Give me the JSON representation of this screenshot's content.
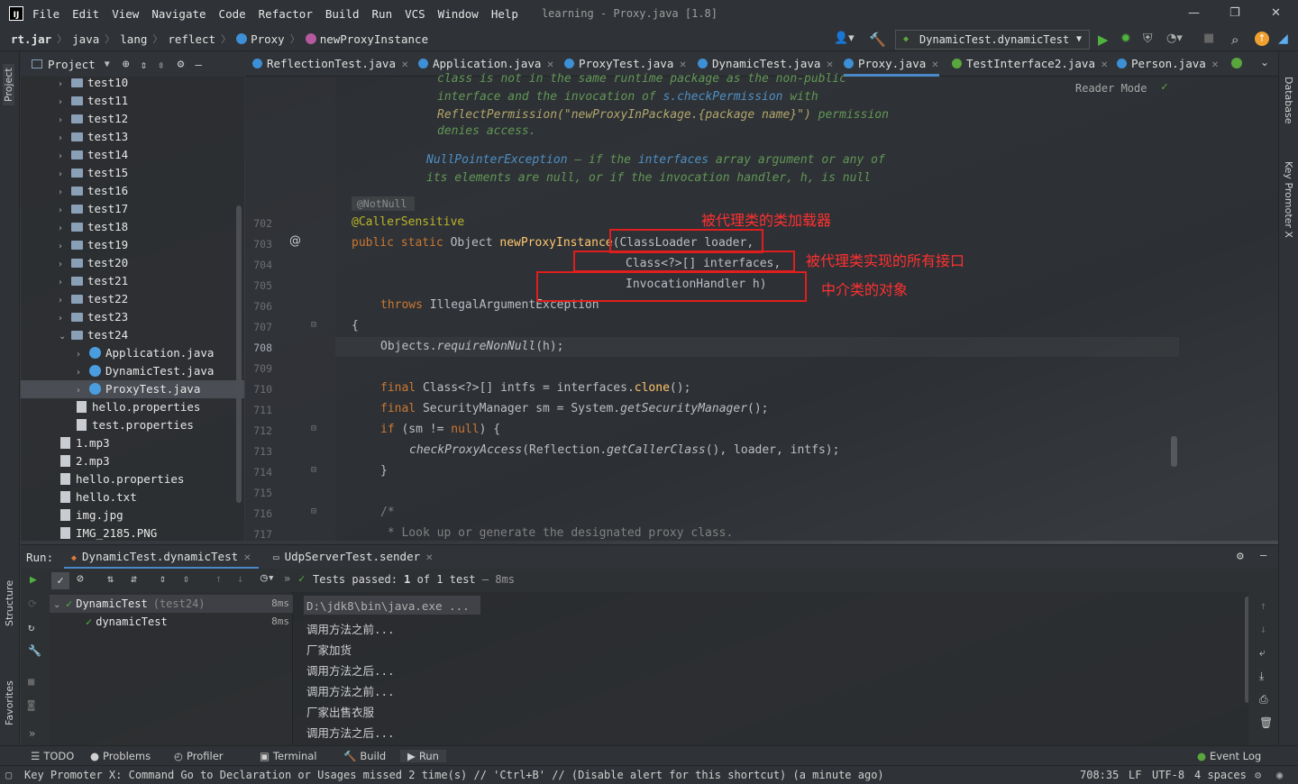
{
  "window": {
    "title": "learning - Proxy.java [1.8]"
  },
  "menu": [
    "File",
    "Edit",
    "View",
    "Navigate",
    "Code",
    "Refactor",
    "Build",
    "Run",
    "VCS",
    "Window",
    "Help"
  ],
  "breadcrumb": [
    "rt.jar",
    "java",
    "lang",
    "reflect",
    "Proxy",
    "newProxyInstance"
  ],
  "run_config": "DynamicTest.dynamicTest",
  "left_strip": {
    "project": "Project",
    "structure": "Structure",
    "favorites": "Favorites"
  },
  "right_strip": {
    "database": "Database",
    "key_promoter": "Key Promoter X"
  },
  "project_panel": {
    "title": "Project"
  },
  "project_tree": [
    {
      "label": "test10",
      "kind": "folder",
      "depth": 0,
      "arrow": "›"
    },
    {
      "label": "test11",
      "kind": "folder",
      "depth": 0,
      "arrow": "›"
    },
    {
      "label": "test12",
      "kind": "folder",
      "depth": 0,
      "arrow": "›"
    },
    {
      "label": "test13",
      "kind": "folder",
      "depth": 0,
      "arrow": "›"
    },
    {
      "label": "test14",
      "kind": "folder",
      "depth": 0,
      "arrow": "›"
    },
    {
      "label": "test15",
      "kind": "folder",
      "depth": 0,
      "arrow": "›"
    },
    {
      "label": "test16",
      "kind": "folder",
      "depth": 0,
      "arrow": "›"
    },
    {
      "label": "test17",
      "kind": "folder",
      "depth": 0,
      "arrow": "›"
    },
    {
      "label": "test18",
      "kind": "folder",
      "depth": 0,
      "arrow": "›"
    },
    {
      "label": "test19",
      "kind": "folder",
      "depth": 0,
      "arrow": "›"
    },
    {
      "label": "test20",
      "kind": "folder",
      "depth": 0,
      "arrow": "›"
    },
    {
      "label": "test21",
      "kind": "folder",
      "depth": 0,
      "arrow": "›"
    },
    {
      "label": "test22",
      "kind": "folder",
      "depth": 0,
      "arrow": "›"
    },
    {
      "label": "test23",
      "kind": "folder",
      "depth": 0,
      "arrow": "›"
    },
    {
      "label": "test24",
      "kind": "folder",
      "depth": 0,
      "arrow": "⌄"
    },
    {
      "label": "Application.java",
      "kind": "java",
      "depth": 1,
      "arrow": "›"
    },
    {
      "label": "DynamicTest.java",
      "kind": "java",
      "depth": 1,
      "arrow": "›"
    },
    {
      "label": "ProxyTest.java",
      "kind": "java",
      "depth": 1,
      "arrow": "›",
      "selected": true
    },
    {
      "label": "hello.properties",
      "kind": "file",
      "depth": 1,
      "arrow": ""
    },
    {
      "label": "test.properties",
      "kind": "file",
      "depth": 1,
      "arrow": ""
    },
    {
      "label": "1.mp3",
      "kind": "file",
      "depth": 0,
      "arrow": ""
    },
    {
      "label": "2.mp3",
      "kind": "file",
      "depth": 0,
      "arrow": ""
    },
    {
      "label": "hello.properties",
      "kind": "file",
      "depth": 0,
      "arrow": ""
    },
    {
      "label": "hello.txt",
      "kind": "file",
      "depth": 0,
      "arrow": ""
    },
    {
      "label": "img.jpg",
      "kind": "file",
      "depth": 0,
      "arrow": ""
    },
    {
      "label": "IMG_2185.PNG",
      "kind": "file",
      "depth": 0,
      "arrow": ""
    }
  ],
  "tabs": [
    {
      "label": "ReflectionTest.java",
      "icon": "c"
    },
    {
      "label": "Application.java",
      "icon": "c"
    },
    {
      "label": "ProxyTest.java",
      "icon": "c"
    },
    {
      "label": "DynamicTest.java",
      "icon": "c"
    },
    {
      "label": "Proxy.java",
      "icon": "c",
      "active": true
    },
    {
      "label": "TestInterface2.java",
      "icon": "i"
    },
    {
      "label": "Person.java",
      "icon": "c"
    }
  ],
  "editor": {
    "reader_mode": "Reader Mode",
    "doc": {
      "l1": "class is not in the same runtime package as the non-public",
      "l2a": "interface and the invocation of ",
      "l2b": "s.checkPermission",
      "l2c": " with",
      "l3a": "ReflectPermission(\"newProxyInPackage.{package name}\")",
      "l3b": " permission",
      "l4": "denies access.",
      "l5a": "NullPointerException",
      "l5b": " – if the ",
      "l5c": "interfaces",
      "l5d": " array argument or any of",
      "l6": "its elements are null, or if the invocation handler, h, is null"
    },
    "notnull": "@NotNull",
    "line_numbers": [
      "702",
      "703",
      "704",
      "705",
      "706",
      "707",
      "708",
      "709",
      "710",
      "711",
      "712",
      "713",
      "714",
      "715",
      "716",
      "717"
    ],
    "code": {
      "l702": "@CallerSensitive",
      "l703a": "public static ",
      "l703b": "Object ",
      "l703c": "newProxyInstance",
      "l703d": "(",
      "l703e": "ClassLoader",
      "l703f": " loader,",
      "l704a": "Class",
      "l704b": "<?>[] interfaces,",
      "l705a": "InvocationHandler",
      "l705b": " h)",
      "l706a": "throws ",
      "l706b": "IllegalArgumentException",
      "l707": "{",
      "l708a": "Objects.",
      "l708b": "requireNonNull",
      "l708c": "(h);",
      "l710a": "final ",
      "l710b": "Class",
      "l710c": "<?>[] intfs = interfaces.",
      "l710d": "clone",
      "l710e": "();",
      "l711a": "final ",
      "l711b": "SecurityManager",
      "l711c": " sm = ",
      "l711d": "System.",
      "l711e": "getSecurityManager",
      "l711f": "();",
      "l712a": "if ",
      "l712b": "(sm != ",
      "l712c": "null",
      "l712d": ") {",
      "l713a": "checkProxyAccess",
      "l713b": "(Reflection.",
      "l713c": "getCallerClass",
      "l713d": "(), loader, intfs);",
      "l714": "}",
      "l716": "/*",
      "l717": " * Look up or generate the designated proxy class."
    },
    "annotations": {
      "a1": "被代理类的类加载器",
      "a2": "被代理类实现的所有接口",
      "a3": "中介类的对象"
    }
  },
  "run_panel": {
    "label": "Run:",
    "tabs": [
      "DynamicTest.dynamicTest",
      "UdpServerTest.sender"
    ],
    "status": "Tests passed:",
    "status_count": "1",
    "status_rest": "of 1 test",
    "status_time": "– 8ms",
    "tree": [
      {
        "name": "DynamicTest",
        "sub": "(test24)",
        "time": "8ms"
      },
      {
        "name": "dynamicTest",
        "sub": "",
        "time": "8ms"
      }
    ],
    "console": [
      "D:\\jdk8\\bin\\java.exe ...",
      "调用方法之前...",
      "厂家加货",
      "调用方法之后...",
      "调用方法之前...",
      "厂家出售衣服",
      "调用方法之后..."
    ]
  },
  "bottom_tools": [
    "TODO",
    "Problems",
    "Profiler",
    "Terminal",
    "Build",
    "Run"
  ],
  "event_log": "Event Log",
  "status": {
    "message": "Key Promoter X: Command Go to Declaration or Usages missed 2 time(s) // 'Ctrl+B' // (Disable alert for this shortcut) (a minute ago)",
    "position": "708:35",
    "line_sep": "LF",
    "encoding": "UTF-8",
    "indent": "4 spaces"
  },
  "colors": {
    "accent": "#4a88c7",
    "annotation_red": "#e01e1e",
    "run_green": "#4fb33d"
  }
}
